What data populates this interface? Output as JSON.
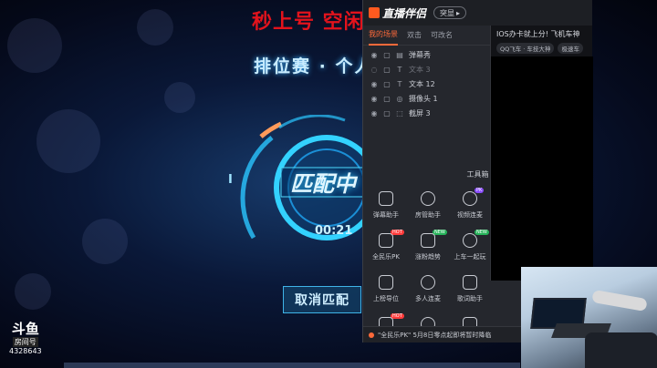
{
  "stream": {
    "banner": "秒上号 空闲",
    "mode_title": "排位赛 · 个人",
    "match_text": "匹配中",
    "roman": "I",
    "timer": "00:21",
    "cancel_label": "取消匹配"
  },
  "watermark": {
    "logo": "斗鱼",
    "sub": "房间号",
    "room_number": "4328643"
  },
  "panel": {
    "brand": "直播伴侣",
    "version_label": "突显",
    "tabs": [
      {
        "label": "我的场景",
        "active": true
      },
      {
        "label": "双击",
        "active": false
      },
      {
        "label": "可改名",
        "active": false
      }
    ],
    "add_icon": "plus-icon",
    "layers": [
      {
        "icon": "danmu-icon",
        "label": "弹幕秀",
        "visible": true
      },
      {
        "icon": "text-icon",
        "label": "文本 3",
        "visible": false
      },
      {
        "icon": "text-icon",
        "label": "文本 12",
        "visible": true
      },
      {
        "icon": "camera-icon",
        "label": "摄像头 1",
        "visible": true
      },
      {
        "icon": "screenshot-icon",
        "label": "截屏 3",
        "visible": true
      }
    ],
    "tools_title": "工具箱",
    "tools": [
      {
        "label": "弹幕助手",
        "icon": "danmu-helper-icon",
        "badge": ""
      },
      {
        "label": "房管助手",
        "icon": "room-manager-icon",
        "badge": ""
      },
      {
        "label": "视频连麦",
        "icon": "video-link-icon",
        "badge": "PK"
      },
      {
        "label": "全民乐PK",
        "icon": "pk-icon",
        "badge": "HOT"
      },
      {
        "label": "涨粉趋势",
        "icon": "fans-trend-icon",
        "badge": "NEW"
      },
      {
        "label": "上车一起玩",
        "icon": "car-play-icon",
        "badge": "NEW"
      },
      {
        "label": "上榜导位",
        "icon": "buff-icon",
        "badge": ""
      },
      {
        "label": "多人连麦",
        "icon": "multi-link-icon",
        "badge": ""
      },
      {
        "label": "歌词助手",
        "icon": "lyrics-icon",
        "badge": ""
      },
      {
        "label": "",
        "icon": "ad-icon",
        "badge": "HOT"
      },
      {
        "label": "",
        "icon": "compass-icon",
        "badge": ""
      },
      {
        "label": "",
        "icon": "gift-box-icon",
        "badge": ""
      }
    ],
    "notice": "\"全民乐PK\" 5月8日零点起即将暂时降临"
  },
  "side": {
    "title": "IOS办卡就上分! 飞机车神",
    "tags": [
      "QQ飞车 · 车技大神",
      "极速车"
    ]
  },
  "colors": {
    "accent": "#ff6a3a",
    "banner_red": "#e3131c",
    "panel_bg": "#25272d"
  }
}
